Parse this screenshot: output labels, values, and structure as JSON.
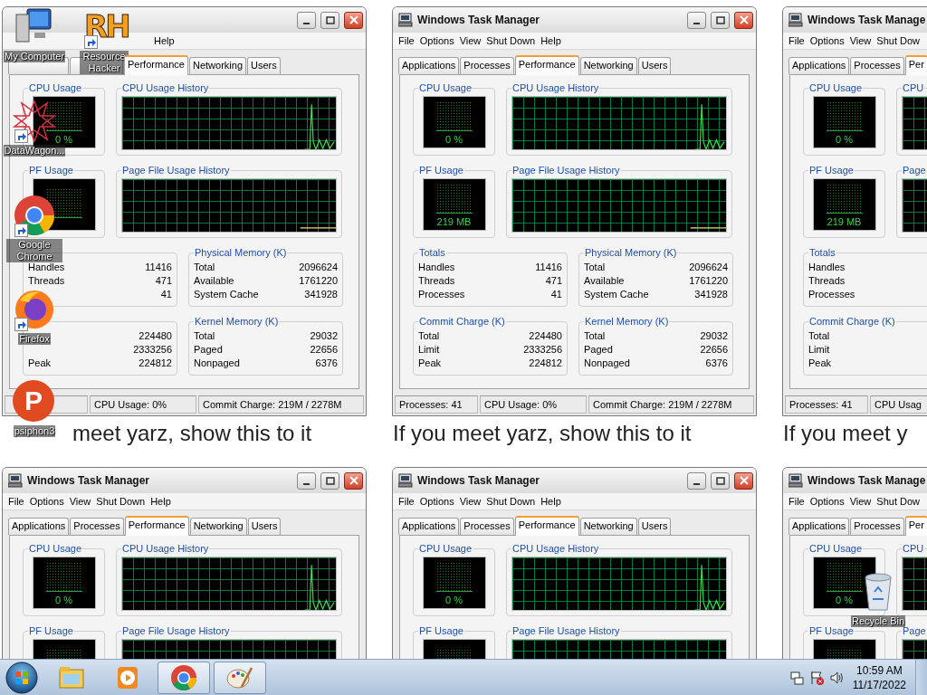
{
  "wallpaper_tiles": [
    {
      "menu": [
        "Help"
      ],
      "tabs": [
        {
          "selected": false
        },
        {
          "selected": false
        },
        {
          "label": "Performance",
          "selected": true
        },
        {
          "label": "Networking",
          "selected": false
        },
        {
          "label": "Users",
          "selected": false
        }
      ],
      "cpu_usage": {
        "title": "CPU Usage",
        "reading": "0 %"
      },
      "cpu_history": {
        "title": "CPU Usage History"
      },
      "pf_usage": {
        "title": "PF Usage"
      },
      "pf_history": {
        "title": "Page File Usage History"
      },
      "totals": {
        "rows": [
          {
            "label": "Handles",
            "value": "11416"
          },
          {
            "label": "Threads",
            "value": "471"
          },
          {
            "value": "41"
          }
        ]
      },
      "physical_memory": {
        "title": "Physical Memory (K)",
        "rows": [
          {
            "label": "Total",
            "value": "2096624"
          },
          {
            "label": "Available",
            "value": "1761220"
          },
          {
            "label": "System Cache",
            "value": "341928"
          }
        ]
      },
      "commit_charge": {
        "rows": [
          {
            "value": "224480"
          },
          {
            "value": "2333256"
          },
          {
            "label": "Peak",
            "value": "224812"
          }
        ]
      },
      "kernel_memory": {
        "title": "Kernel Memory (K)",
        "rows": [
          {
            "label": "Total",
            "value": "29032"
          },
          {
            "label": "Paged",
            "value": "22656"
          },
          {
            "label": "Nonpaged",
            "value": "6376"
          }
        ]
      },
      "status_bar": [
        "CPU Usage: 0%",
        "Commit Charge: 219M / 2278M"
      ],
      "caption": "meet yarz, show this to it"
    },
    {
      "title": "Windows Task Manager",
      "menu": [
        "File",
        "Options",
        "View",
        "Shut Down",
        "Help"
      ],
      "tabs": [
        {
          "label": "Applications",
          "selected": false
        },
        {
          "label": "Processes",
          "selected": false
        },
        {
          "label": "Performance",
          "selected": true
        },
        {
          "label": "Networking",
          "selected": false
        },
        {
          "label": "Users",
          "selected": false
        }
      ],
      "cpu_usage": {
        "title": "CPU Usage",
        "reading": "0 %"
      },
      "cpu_history": {
        "title": "CPU Usage History"
      },
      "pf_usage": {
        "title": "PF Usage",
        "reading": "219 MB"
      },
      "pf_history": {
        "title": "Page File Usage History"
      },
      "totals": {
        "title": "Totals",
        "rows": [
          {
            "label": "Handles",
            "value": "11416"
          },
          {
            "label": "Threads",
            "value": "471"
          },
          {
            "label": "Processes",
            "value": "41"
          }
        ]
      },
      "physical_memory": {
        "title": "Physical Memory (K)",
        "rows": [
          {
            "label": "Total",
            "value": "2096624"
          },
          {
            "label": "Available",
            "value": "1761220"
          },
          {
            "label": "System Cache",
            "value": "341928"
          }
        ]
      },
      "commit_charge": {
        "title": "Commit Charge (K)",
        "rows": [
          {
            "label": "Total",
            "value": "224480"
          },
          {
            "label": "Limit",
            "value": "2333256"
          },
          {
            "label": "Peak",
            "value": "224812"
          }
        ]
      },
      "kernel_memory": {
        "title": "Kernel Memory (K)",
        "rows": [
          {
            "label": "Total",
            "value": "29032"
          },
          {
            "label": "Paged",
            "value": "22656"
          },
          {
            "label": "Nonpaged",
            "value": "6376"
          }
        ]
      },
      "status_bar": [
        "Processes: 41",
        "CPU Usage: 0%",
        "Commit Charge: 219M / 2278M"
      ],
      "caption": "If you meet yarz, show this to it"
    },
    {
      "title": "Windows Task Manage",
      "menu": [
        "File",
        "Options",
        "View",
        "Shut Dow"
      ],
      "tabs": [
        {
          "label": "Applications",
          "selected": false
        },
        {
          "label": "Processes",
          "selected": false
        },
        {
          "label": "Per",
          "selected": true
        }
      ],
      "cpu_usage": {
        "title": "CPU Usage",
        "reading": "0 %"
      },
      "cpu_history": {
        "title": "CPU"
      },
      "pf_usage": {
        "title": "PF Usage",
        "reading": "219 MB"
      },
      "pf_history": {
        "title": "Page"
      },
      "totals": {
        "title": "Totals",
        "rows": [
          {
            "label": "Handles"
          },
          {
            "label": "Threads"
          },
          {
            "label": "Processes"
          }
        ]
      },
      "commit_charge": {
        "title": "Commit Charge (K)",
        "rows": [
          {
            "label": "Total"
          },
          {
            "label": "Limit"
          },
          {
            "label": "Peak"
          }
        ]
      },
      "status_bar": [
        "Processes: 41",
        "CPU Usag"
      ],
      "caption": "If you meet y"
    },
    {
      "title": "Windows Task Manager",
      "menu": [
        "File",
        "Options",
        "View",
        "Shut Down",
        "Help"
      ],
      "tabs": [
        {
          "label": "Applications",
          "selected": false
        },
        {
          "label": "Processes",
          "selected": false
        },
        {
          "label": "Performance",
          "selected": true
        },
        {
          "label": "Networking",
          "selected": false
        },
        {
          "label": "Users",
          "selected": false
        }
      ],
      "cpu_usage": {
        "title": "CPU Usage",
        "reading": "0 %"
      },
      "cpu_history": {
        "title": "CPU Usage History"
      },
      "pf_usage": {
        "title": "PF Usage"
      },
      "pf_history": {
        "title": "Page File Usage History"
      }
    },
    {
      "title": "Windows Task Manager",
      "menu": [
        "File",
        "Options",
        "View",
        "Shut Down",
        "Help"
      ],
      "tabs": [
        {
          "label": "Applications",
          "selected": false
        },
        {
          "label": "Processes",
          "selected": false
        },
        {
          "label": "Performance",
          "selected": true
        },
        {
          "label": "Networking",
          "selected": false
        },
        {
          "label": "Users",
          "selected": false
        }
      ],
      "cpu_usage": {
        "title": "CPU Usage",
        "reading": "0 %"
      },
      "cpu_history": {
        "title": "CPU Usage History"
      },
      "pf_usage": {
        "title": "PF Usage"
      },
      "pf_history": {
        "title": "Page File Usage History"
      }
    },
    {
      "title": "Windows Task Manage",
      "menu": [
        "File",
        "Options",
        "View",
        "Shut Dow"
      ],
      "tabs": [
        {
          "label": "Applications",
          "selected": false
        },
        {
          "label": "Processes",
          "selected": false
        },
        {
          "label": "Per",
          "selected": true
        }
      ],
      "cpu_usage": {
        "title": "CPU Usage",
        "reading": "0 %"
      },
      "cpu_history": {
        "title": "CPU"
      },
      "pf_usage": {
        "title": "PF Usage"
      },
      "pf_history": {
        "title": "Page"
      }
    }
  ],
  "desktop_icons": [
    {
      "kind": "computer",
      "label": "My Computer",
      "shortcut": false
    },
    {
      "kind": "resource-hacker",
      "label": "Resource Hacker",
      "logo_text": "RH",
      "shortcut": true
    },
    {
      "kind": "datawagon",
      "label": "DataWagon...",
      "shortcut": true
    },
    {
      "kind": "chrome",
      "label": "Google Chrome",
      "shortcut": true
    },
    {
      "kind": "firefox",
      "label": "Firefox",
      "shortcut": true
    },
    {
      "kind": "psiphon",
      "label": "psiphon3",
      "logo_text": "P",
      "shortcut": false
    },
    {
      "kind": "recycle-bin",
      "label": "Recycle Bin",
      "shortcut": false
    }
  ],
  "taskbar": {
    "buttons": [
      {
        "kind": "explorer",
        "running": false
      },
      {
        "kind": "media-player",
        "running": false
      },
      {
        "kind": "chrome",
        "running": true
      },
      {
        "kind": "paint",
        "running": true
      }
    ],
    "clock": {
      "time": "10:59 AM",
      "date": "11/17/2022"
    }
  }
}
